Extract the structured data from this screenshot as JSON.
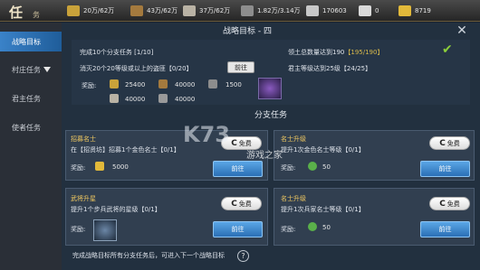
{
  "header": {
    "title": "任",
    "title_sub": "务",
    "resources": [
      {
        "icon": "food-icon",
        "value": "20万/62万"
      },
      {
        "icon": "wood-icon",
        "value": "43万/62万"
      },
      {
        "icon": "stone-icon",
        "value": "37万/62万"
      },
      {
        "icon": "iron-icon",
        "value": "1.82万/3.14万"
      },
      {
        "icon": "copper-icon",
        "value": "170603"
      },
      {
        "icon": "crown-icon",
        "value": "0"
      },
      {
        "icon": "gold-icon",
        "value": "8719"
      }
    ]
  },
  "sidebar": {
    "items": [
      {
        "label": "战略目标",
        "active": true
      },
      {
        "label": "村庄任务",
        "active": false
      },
      {
        "label": "君主任务",
        "active": false
      },
      {
        "label": "使者任务",
        "active": false
      }
    ]
  },
  "goal": {
    "header": "战略目标 - 四",
    "tasks": [
      {
        "text": "完成10个分支任务",
        "progress": "[1/10]"
      },
      {
        "text": "消灭20个20等级或以上的盗匪",
        "progress": "【0/20】",
        "button": "前往"
      },
      {
        "text": "领土总数量达到190",
        "progress": "【195/190】",
        "done": true
      },
      {
        "text": "君主等级达到25级",
        "progress": "【24/25】"
      }
    ],
    "reward_label": "奖励:",
    "rewards": [
      "25400",
      "40000",
      "1500",
      "40000",
      "40000"
    ]
  },
  "branch": {
    "header": "分支任务",
    "cards": [
      {
        "title": "招募名士",
        "desc": "在【招贤坊】招募1个金色名士【0/1】",
        "free": "免费",
        "reward_label": "奖励:",
        "reward_value": "5000",
        "goto": "前往"
      },
      {
        "title": "名士升级",
        "desc": "提升1次金色名士等级【0/1】",
        "free": "免费",
        "reward_label": "奖励:",
        "reward_value": "50",
        "goto": "前往"
      },
      {
        "title": "武将升星",
        "desc": "提升1个步兵武将的星级【0/1】",
        "free": "免费",
        "reward_label": "奖励:",
        "goto": "前往"
      },
      {
        "title": "名士升级",
        "desc": "提升1次兵家名士等级【0/1】",
        "free": "免费",
        "reward_label": "奖励:",
        "reward_value": "50",
        "goto": "前往"
      }
    ],
    "footer": "完成战略目标所有分支任务后，可进入下一个战略目标",
    "help": "?"
  },
  "watermark": {
    "logo": "K73",
    "text": "游戏之家"
  },
  "colors": {
    "accent_blue": "#2a6fb5",
    "highlight_gold": "#d6b84b",
    "check_green": "#8ccf3a"
  }
}
